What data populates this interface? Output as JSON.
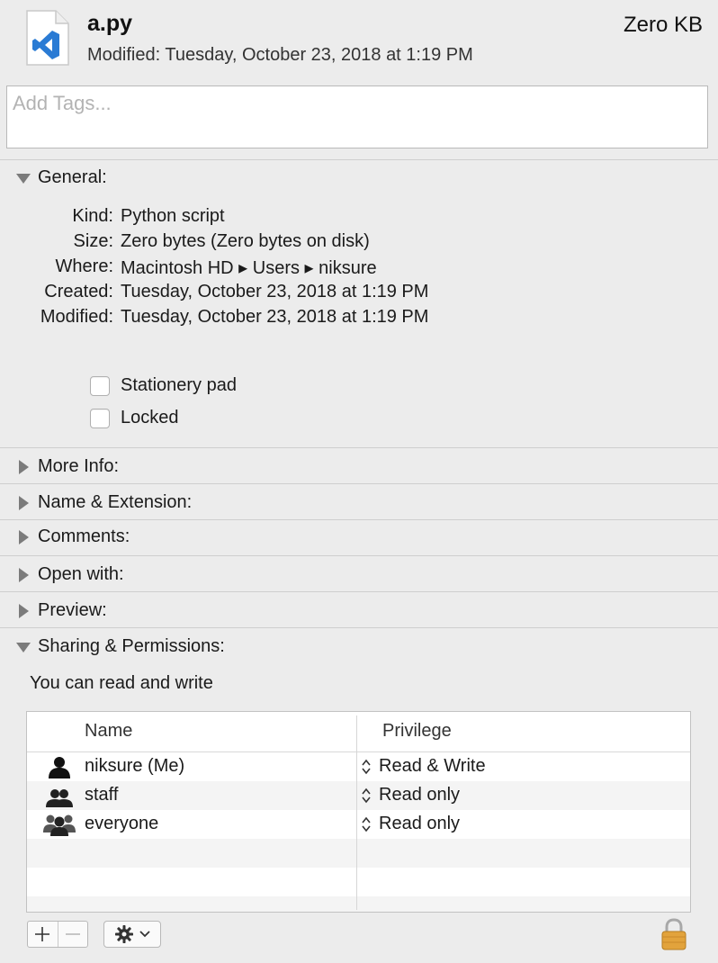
{
  "header": {
    "file_name": "a.py",
    "modified_label": "Modified:",
    "modified_value": "Tuesday, October 23, 2018 at 1:19 PM",
    "size": "Zero KB",
    "file_icon": "vscode-document-icon"
  },
  "tags": {
    "placeholder": "Add Tags..."
  },
  "general": {
    "title": "General:",
    "expanded": true,
    "rows": [
      {
        "label": "Kind:",
        "value": "Python script"
      },
      {
        "label": "Size:",
        "value": "Zero bytes (Zero bytes on disk)"
      },
      {
        "label": "Where:",
        "value": "Macintosh HD ▸ Users ▸ niksure"
      },
      {
        "label": "Created:",
        "value": "Tuesday, October 23, 2018 at 1:19 PM"
      },
      {
        "label": "Modified:",
        "value": "Tuesday, October 23, 2018 at 1:19 PM"
      }
    ],
    "stationery_label": "Stationery pad",
    "stationery_checked": false,
    "locked_label": "Locked",
    "locked_checked": false
  },
  "sections": [
    {
      "title": "More Info:",
      "expanded": false
    },
    {
      "title": "Name & Extension:",
      "expanded": false
    },
    {
      "title": "Comments:",
      "expanded": false
    },
    {
      "title": "Open with:",
      "expanded": false
    },
    {
      "title": "Preview:",
      "expanded": false
    }
  ],
  "sharing": {
    "title": "Sharing & Permissions:",
    "expanded": true,
    "note": "You can read and write",
    "columns": {
      "name": "Name",
      "privilege": "Privilege"
    },
    "rows": [
      {
        "name": "niksure (Me)",
        "privilege": "Read & Write",
        "icon": "single-user-icon"
      },
      {
        "name": "staff",
        "privilege": "Read only",
        "icon": "group-icon"
      },
      {
        "name": "everyone",
        "privilege": "Read only",
        "icon": "everyone-icon"
      }
    ]
  },
  "colors": {
    "window_bg": "#ececec",
    "vscode_blue": "#2a7bd4",
    "lock_gold": "#e2a33c"
  }
}
